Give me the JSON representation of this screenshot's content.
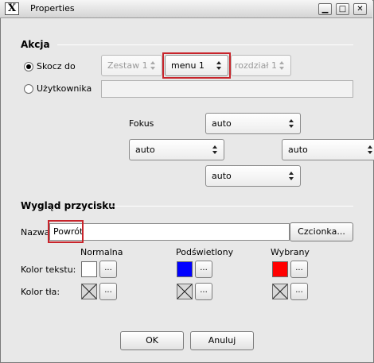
{
  "window": {
    "title": "Properties",
    "app_icon_glyph": "X",
    "controls": {
      "minimize": "▁",
      "maximize": "□",
      "close": "✕"
    }
  },
  "action": {
    "section_title": "Akcja",
    "jump_to": {
      "label": "Skocz do",
      "selected": true,
      "set_combo": "Zestaw 1",
      "menu_combo": "menu 1",
      "chapter_combo": "rozdział 1"
    },
    "user": {
      "label": "Użytkownika",
      "selected": false,
      "value": ""
    },
    "focus": {
      "label": "Fokus",
      "up": "auto",
      "left": "auto",
      "right": "auto",
      "down": "auto"
    }
  },
  "appearance": {
    "section_title": "Wygląd przycisku",
    "name_label": "Nazwa",
    "name_value": "Powrót",
    "font_button": "Czcionka...",
    "columns": {
      "normal": "Normalna",
      "highlighted": "Podświetlony",
      "selected": "Wybrany"
    },
    "text_color_label": "Kolor tekstu:",
    "bg_color_label": "Kolor tła:",
    "colors": {
      "text_normal": "#ffffff",
      "text_highlighted": "#0000ff",
      "text_selected": "#ff0000"
    },
    "ellipsis": "..."
  },
  "footer": {
    "ok": "OK",
    "cancel": "Anuluj"
  }
}
